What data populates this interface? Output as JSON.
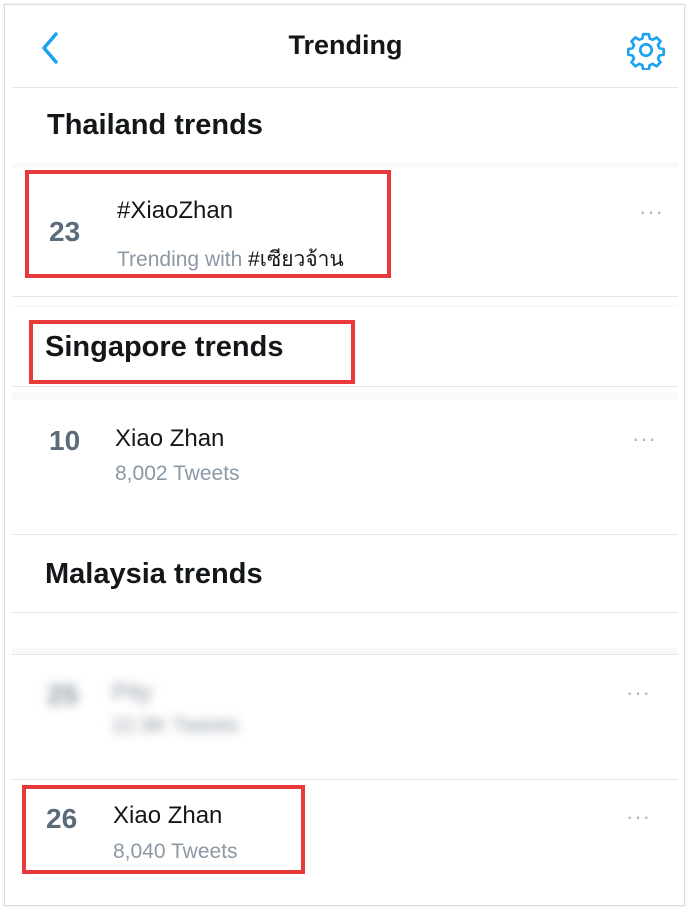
{
  "header": {
    "title": "Trending"
  },
  "sections": [
    {
      "heading": "Thailand trends",
      "trends": [
        {
          "rank": "23",
          "name": "#XiaoZhan",
          "meta_prefix": "Trending with ",
          "meta_tag": "#เซียวจ้าน",
          "more": "···"
        }
      ]
    },
    {
      "heading": "Singapore trends",
      "trends": [
        {
          "rank": "10",
          "name": "Xiao Zhan",
          "meta": "8,002 Tweets",
          "more": "···"
        }
      ]
    },
    {
      "heading": "Malaysia trends",
      "trends": [
        {
          "rank": "25",
          "name": "Pity",
          "meta": "22.9K Tweets",
          "more": "···"
        },
        {
          "rank": "26",
          "name": "Xiao Zhan",
          "meta": "8,040 Tweets",
          "more": "···"
        }
      ]
    }
  ],
  "colors": {
    "accent": "#1da1f2",
    "highlight_box": "#e8393b"
  }
}
